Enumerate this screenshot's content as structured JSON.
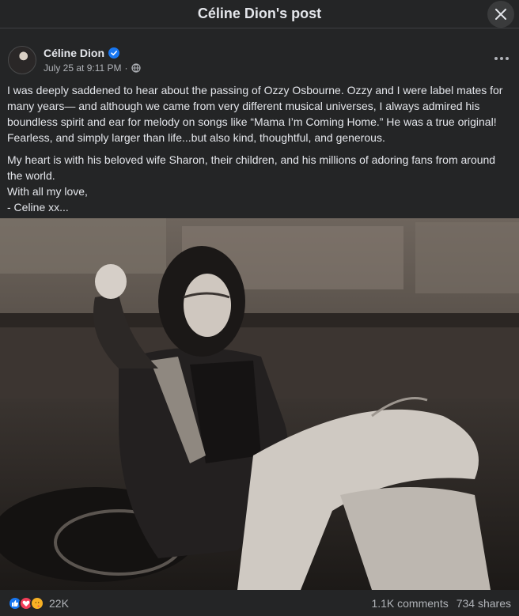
{
  "header": {
    "title": "Céline Dion's post"
  },
  "post": {
    "author": "Céline Dion",
    "timestamp": "July 25 at 9:11 PM",
    "separator": "·",
    "paragraphs": [
      "I was deeply saddened to hear about the passing of Ozzy Osbourne. Ozzy and I were label mates for many years— and although we came from very different musical universes, I always admired his boundless spirit and ear for melody on songs like “Mama I’m Coming Home.” He was a true original! Fearless, and simply larger than life...but also kind, thoughtful, and generous.",
      "My heart is with his beloved wife Sharon, their children, and his millions of adoring fans from around the world.",
      "With all my love,",
      "- Celine xx..."
    ]
  },
  "footer": {
    "reaction_count": "22K",
    "comments": "1.1K comments",
    "shares": "734 shares"
  },
  "icons": {
    "verified": "verified-badge-icon",
    "privacy": "globe-icon",
    "close": "close-icon",
    "more": "more-options-icon",
    "reactions": [
      "like-icon",
      "love-icon",
      "care-icon"
    ]
  },
  "colors": {
    "background": "#242526",
    "text": "#e4e6eb",
    "secondary_text": "#b0b3b8",
    "verified": "#1877f2",
    "like": "#1877f2",
    "love": "#f33e58",
    "care": "#f7b125"
  }
}
